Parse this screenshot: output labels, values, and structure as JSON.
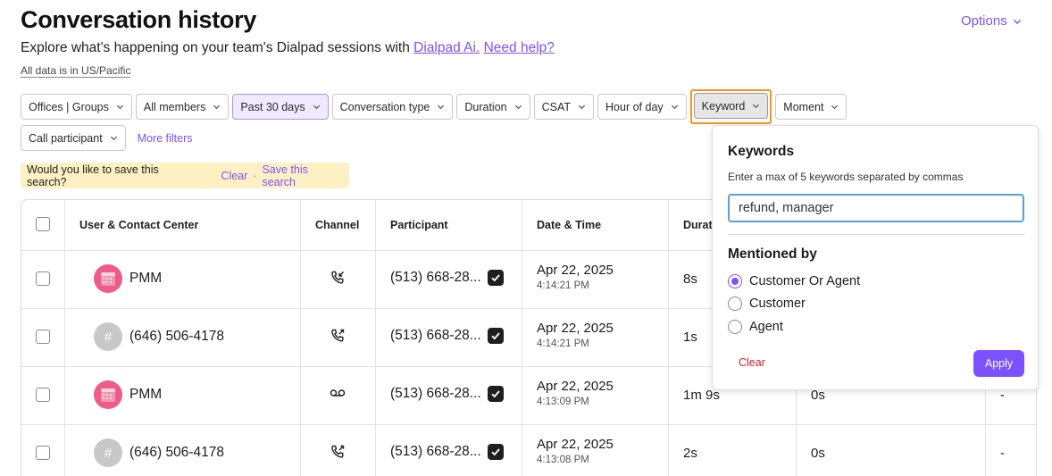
{
  "header": {
    "title": "Conversation history",
    "options_label": "Options",
    "subtitle_text": "Explore what's happening on your team's Dialpad sessions with",
    "dialpad_ai_link": "Dialpad Ai.",
    "need_help_link": "Need help?",
    "timezone_note": "All data is in US/Pacific"
  },
  "filters": {
    "offices_groups": "Offices | Groups",
    "all_members": "All members",
    "past_30_days": "Past 30 days",
    "conversation_type": "Conversation type",
    "duration": "Duration",
    "csat": "CSAT",
    "hour_of_day": "Hour of day",
    "keyword": "Keyword",
    "moment": "Moment",
    "call_participant": "Call participant",
    "more_filters": "More filters"
  },
  "save_search": {
    "prompt": "Would you like to save this search?",
    "clear": "Clear",
    "separator": "·",
    "save": "Save this search"
  },
  "table": {
    "columns": {
      "user": "User & Contact Center",
      "channel": "Channel",
      "participant": "Participant",
      "datetime": "Date & Time",
      "duration": "Durat"
    },
    "rows": [
      {
        "avatar": "calendar",
        "user": "PMM",
        "channel_icon": "incoming-call-icon",
        "participant": "(513) 668-28...",
        "date": "Apr 22, 2025",
        "time": "4:14:21 PM",
        "duration": "8s",
        "col6": "",
        "col7": ""
      },
      {
        "avatar": "hash",
        "avatar_text": "#",
        "user": "(646) 506-4178",
        "channel_icon": "outgoing-call-icon",
        "participant": "(513) 668-28...",
        "date": "Apr 22, 2025",
        "time": "4:14:21 PM",
        "duration": "1s",
        "col6": "",
        "col7": ""
      },
      {
        "avatar": "calendar",
        "user": "PMM",
        "channel_icon": "voicemail-icon",
        "participant": "(513) 668-28...",
        "date": "Apr 22, 2025",
        "time": "4:13:09 PM",
        "duration": "1m 9s",
        "col6": "0s",
        "col7": "-"
      },
      {
        "avatar": "hash",
        "avatar_text": "#",
        "user": "(646) 506-4178",
        "channel_icon": "outgoing-call-icon",
        "participant": "(513) 668-28...",
        "date": "Apr 22, 2025",
        "time": "4:13:08 PM",
        "duration": "2s",
        "col6": "0s",
        "col7": "-"
      }
    ]
  },
  "keyword_popover": {
    "title": "Keywords",
    "help": "Enter a max of 5 keywords separated by commas",
    "input_value": "refund, manager",
    "mentioned_by_title": "Mentioned by",
    "options": [
      "Customer Or Agent",
      "Customer",
      "Agent"
    ],
    "selected_option": "Customer Or Agent",
    "clear": "Clear",
    "apply": "Apply"
  },
  "colors": {
    "accent": "#7c52ff",
    "highlight_ring": "#f7931e",
    "save_bar_bg": "#fdf1c4",
    "danger": "#d0202e"
  }
}
